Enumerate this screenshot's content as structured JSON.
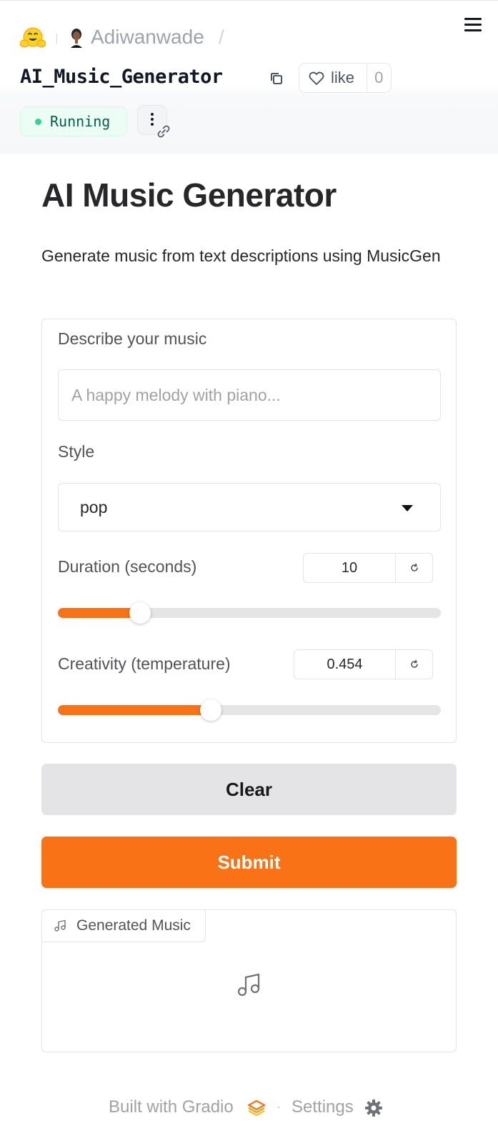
{
  "header": {
    "owner": "Adiwanwade",
    "slash": "/",
    "space_name": "AI_Music_Generator",
    "like_label": "like",
    "like_count": "0",
    "status": "Running"
  },
  "app": {
    "title": "AI Music Generator",
    "description": "Generate music from text descriptions using MusicGen",
    "prompt": {
      "label": "Describe your music",
      "placeholder": "A happy melody with piano...",
      "value": ""
    },
    "style": {
      "label": "Style",
      "selected": "pop"
    },
    "duration": {
      "label": "Duration (seconds)",
      "value": "10",
      "fill_fraction": 0.215
    },
    "creativity": {
      "label": "Creativity (temperature)",
      "value": "0.454",
      "fill_fraction": 0.4
    },
    "clear_label": "Clear",
    "submit_label": "Submit",
    "output": {
      "label": "Generated Music"
    }
  },
  "footer": {
    "built_with": "Built with Gradio",
    "separator": "·",
    "settings": "Settings"
  },
  "colors": {
    "accent": "#f97316",
    "running_bg": "#ecfdf5",
    "running_dot": "#34d399"
  }
}
